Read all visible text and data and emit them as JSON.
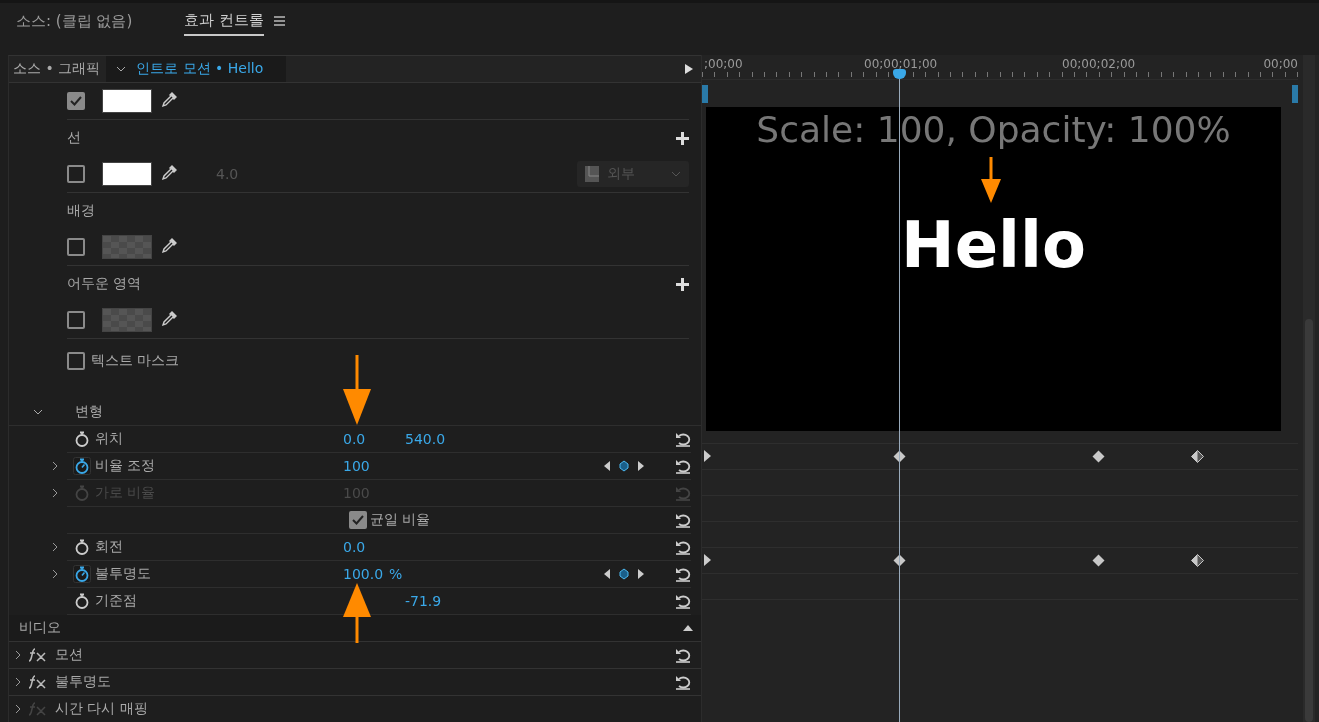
{
  "tabs": [
    {
      "label": "소스: (클립 없음)",
      "selected": false
    },
    {
      "label": "효과 컨트롤",
      "selected": true
    }
  ],
  "effect_header": {
    "source": "소스 • 그래픽",
    "clip": "인트로 모션 • Hello"
  },
  "graphic_rows": [
    {
      "kind": "swatch",
      "checked": true,
      "transparent": false
    },
    {
      "kind": "section",
      "label": "선",
      "addable": true
    },
    {
      "kind": "swatch",
      "checked": false,
      "transparent": false,
      "value": "4.0",
      "dropdown": "외부"
    },
    {
      "kind": "section",
      "label": "배경",
      "addable": false
    },
    {
      "kind": "swatch",
      "checked": false,
      "transparent": true
    },
    {
      "kind": "section",
      "label": "어두운 영역",
      "addable": true
    },
    {
      "kind": "swatch",
      "checked": false,
      "transparent": true
    },
    {
      "kind": "checkbox",
      "label": "텍스트 마스크",
      "checked": false
    }
  ],
  "transform": {
    "label": "변형",
    "expanded": true,
    "properties": [
      {
        "kind": "value",
        "name": "위치",
        "value_1": "0.0",
        "value_2": "540.0",
        "expandable": false,
        "animated": false,
        "disabled": false
      },
      {
        "kind": "value",
        "name": "비율 조정",
        "value_1": "100",
        "expandable": true,
        "animated": true,
        "disabled": false,
        "keyframes": [
          {
            "kind": "edge",
            "level": 0
          },
          {
            "kind": "key",
            "level": 0.33
          },
          {
            "kind": "key",
            "level": 0.665
          },
          {
            "kind": "half",
            "level": 0.83
          }
        ]
      },
      {
        "kind": "value",
        "name": "가로 비율",
        "value_1": "100",
        "expandable": true,
        "animated": false,
        "disabled": true
      },
      {
        "kind": "checkbox",
        "label": "균일 비율",
        "checked": true
      },
      {
        "kind": "value",
        "name": "회전",
        "value_1": "0.0",
        "expandable": true,
        "animated": false,
        "disabled": false
      },
      {
        "kind": "value",
        "name": "불투명도",
        "value_1": "100.0",
        "unit": "%",
        "expandable": true,
        "animated": true,
        "disabled": false,
        "keyframes": [
          {
            "kind": "edge",
            "level": 0
          },
          {
            "kind": "key",
            "level": 0.33
          },
          {
            "kind": "key",
            "level": 0.665
          },
          {
            "kind": "half",
            "level": 0.83
          }
        ]
      },
      {
        "kind": "value",
        "name": "기준점",
        "value_2": "-71.9",
        "expandable": false,
        "animated": false,
        "disabled": false
      }
    ]
  },
  "video": {
    "label": "비디오",
    "effects": [
      {
        "name": "모션",
        "disabled": false
      },
      {
        "name": "불투명도",
        "disabled": false
      },
      {
        "name": "시간 다시 매핑",
        "disabled": true
      }
    ]
  },
  "timeline": {
    "ruler_labels": [
      ";00;00",
      "00;00;01;00",
      "00;00;02;00",
      "00;00"
    ],
    "playhead": {
      "level": 0.33
    }
  },
  "preview": {
    "caption": "Scale: 100, Opacity: 100%",
    "title": "Hello"
  }
}
